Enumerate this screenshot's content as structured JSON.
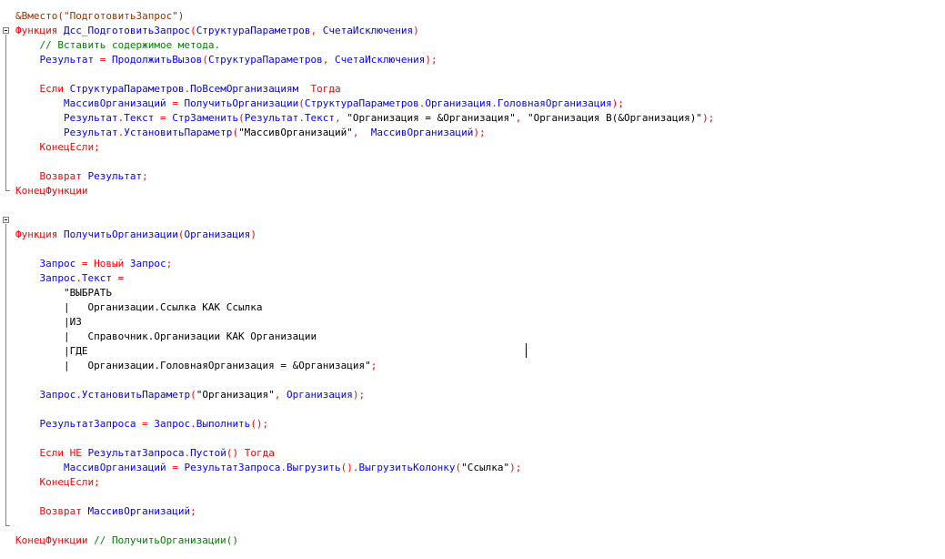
{
  "lines": [
    {
      "name": "line-directive",
      "segs": [
        {
          "t": "&Вместо(\"ПодготовитьЗапрос\")",
          "c": "pp"
        }
      ]
    },
    {
      "name": "line-function-1-header",
      "segs": [
        {
          "t": "Функция ",
          "c": "kw"
        },
        {
          "t": "Дсс_ПодготовитьЗапрос",
          "c": "id"
        },
        {
          "t": "(",
          "c": "kw"
        },
        {
          "t": "СтруктураПараметров",
          "c": "id"
        },
        {
          "t": ", ",
          "c": "kw"
        },
        {
          "t": "СчетаИсключения",
          "c": "id"
        },
        {
          "t": ")",
          "c": "kw"
        }
      ]
    },
    {
      "name": "line-comment-insert",
      "segs": [
        {
          "t": "    // Вставить содержимое метода.",
          "c": "cm"
        }
      ]
    },
    {
      "name": "line-result-assign",
      "segs": [
        {
          "t": "    Результат",
          "c": "id"
        },
        {
          "t": " = ",
          "c": "kw"
        },
        {
          "t": "ПродолжитьВызов",
          "c": "id"
        },
        {
          "t": "(",
          "c": "kw"
        },
        {
          "t": "СтруктураПараметров",
          "c": "id"
        },
        {
          "t": ", ",
          "c": "kw"
        },
        {
          "t": "СчетаИсключения",
          "c": "id"
        },
        {
          "t": ");",
          "c": "kw"
        }
      ]
    },
    {
      "name": "line-blank-1",
      "segs": []
    },
    {
      "name": "line-if-all-orgs",
      "segs": [
        {
          "t": "    Если ",
          "c": "kw"
        },
        {
          "t": "СтруктураПараметров",
          "c": "id"
        },
        {
          "t": ".",
          "c": "kw"
        },
        {
          "t": "ПоВсемОрганизациям",
          "c": "id"
        },
        {
          "t": "  Тогда",
          "c": "kw"
        }
      ]
    },
    {
      "name": "line-orgs-array",
      "segs": [
        {
          "t": "        МассивОрганизаций",
          "c": "id"
        },
        {
          "t": " = ",
          "c": "kw"
        },
        {
          "t": "ПолучитьОрганизации",
          "c": "id"
        },
        {
          "t": "(",
          "c": "kw"
        },
        {
          "t": "СтруктураПараметров",
          "c": "id"
        },
        {
          "t": ".",
          "c": "kw"
        },
        {
          "t": "Организация",
          "c": "id"
        },
        {
          "t": ".",
          "c": "kw"
        },
        {
          "t": "ГоловнаяОрганизация",
          "c": "id"
        },
        {
          "t": ");",
          "c": "kw"
        }
      ]
    },
    {
      "name": "line-replace-text",
      "segs": [
        {
          "t": "        Результат",
          "c": "id"
        },
        {
          "t": ".",
          "c": "kw"
        },
        {
          "t": "Текст",
          "c": "id"
        },
        {
          "t": " = ",
          "c": "kw"
        },
        {
          "t": "СтрЗаменить",
          "c": "id"
        },
        {
          "t": "(",
          "c": "kw"
        },
        {
          "t": "Результат",
          "c": "id"
        },
        {
          "t": ".",
          "c": "kw"
        },
        {
          "t": "Текст",
          "c": "id"
        },
        {
          "t": ", ",
          "c": "kw"
        },
        {
          "t": "\"Организация = &Организация\"",
          "c": "str"
        },
        {
          "t": ", ",
          "c": "kw"
        },
        {
          "t": "\"Организация В(&Организация)\"",
          "c": "str"
        },
        {
          "t": ");",
          "c": "kw"
        }
      ]
    },
    {
      "name": "line-set-param",
      "segs": [
        {
          "t": "        Результат",
          "c": "id"
        },
        {
          "t": ".",
          "c": "kw"
        },
        {
          "t": "УстановитьПараметр",
          "c": "id"
        },
        {
          "t": "(",
          "c": "kw"
        },
        {
          "t": "\"МассивОрганизаций\"",
          "c": "str"
        },
        {
          "t": ",  ",
          "c": "kw"
        },
        {
          "t": "МассивОрганизаций",
          "c": "id"
        },
        {
          "t": ");",
          "c": "kw"
        }
      ]
    },
    {
      "name": "line-endif-1",
      "segs": [
        {
          "t": "    КонецЕсли;",
          "c": "kw"
        }
      ]
    },
    {
      "name": "line-blank-2",
      "segs": []
    },
    {
      "name": "line-return-result",
      "segs": [
        {
          "t": "    Возврат ",
          "c": "kw"
        },
        {
          "t": "Результат",
          "c": "id"
        },
        {
          "t": ";",
          "c": "kw"
        }
      ]
    },
    {
      "name": "line-end-function-1",
      "segs": [
        {
          "t": "КонецФункции",
          "c": "kw"
        }
      ]
    },
    {
      "name": "line-blank-3",
      "segs": []
    },
    {
      "name": "line-blank-4",
      "segs": []
    },
    {
      "name": "line-function-2-header",
      "segs": [
        {
          "t": "Функция ",
          "c": "kw"
        },
        {
          "t": "ПолучитьОрганизации",
          "c": "id"
        },
        {
          "t": "(",
          "c": "kw"
        },
        {
          "t": "Организация",
          "c": "id"
        },
        {
          "t": ")",
          "c": "kw"
        }
      ]
    },
    {
      "name": "line-blank-5",
      "segs": []
    },
    {
      "name": "line-query-new",
      "segs": [
        {
          "t": "    Запрос",
          "c": "id"
        },
        {
          "t": " = ",
          "c": "kw"
        },
        {
          "t": "Новый ",
          "c": "kw"
        },
        {
          "t": "Запрос",
          "c": "id"
        },
        {
          "t": ";",
          "c": "kw"
        }
      ]
    },
    {
      "name": "line-query-text",
      "segs": [
        {
          "t": "    Запрос",
          "c": "id"
        },
        {
          "t": ".",
          "c": "kw"
        },
        {
          "t": "Текст",
          "c": "id"
        },
        {
          "t": " =",
          "c": "kw"
        }
      ]
    },
    {
      "name": "line-q-select",
      "segs": [
        {
          "t": "        \"ВЫБРАТЬ",
          "c": "str"
        }
      ]
    },
    {
      "name": "line-q-field",
      "segs": [
        {
          "t": "        |   Организации.Ссылка КАК Ссылка",
          "c": "str"
        }
      ]
    },
    {
      "name": "line-q-from",
      "segs": [
        {
          "t": "        |ИЗ",
          "c": "str"
        }
      ]
    },
    {
      "name": "line-q-source",
      "segs": [
        {
          "t": "        |   Справочник.Организации КАК Организации",
          "c": "str"
        }
      ]
    },
    {
      "name": "line-q-where",
      "segs": [
        {
          "t": "        |ГДЕ",
          "c": "str"
        }
      ]
    },
    {
      "name": "line-q-condition",
      "segs": [
        {
          "t": "        |   Организации.ГоловнаяОрганизация = &Организация\"",
          "c": "str"
        },
        {
          "t": ";",
          "c": "kw"
        }
      ]
    },
    {
      "name": "line-blank-6",
      "segs": []
    },
    {
      "name": "line-query-set-param",
      "segs": [
        {
          "t": "    Запрос",
          "c": "id"
        },
        {
          "t": ".",
          "c": "kw"
        },
        {
          "t": "УстановитьПараметр",
          "c": "id"
        },
        {
          "t": "(",
          "c": "kw"
        },
        {
          "t": "\"Организация\"",
          "c": "str"
        },
        {
          "t": ", ",
          "c": "kw"
        },
        {
          "t": "Организация",
          "c": "id"
        },
        {
          "t": ");",
          "c": "kw"
        }
      ]
    },
    {
      "name": "line-blank-7",
      "segs": []
    },
    {
      "name": "line-query-execute",
      "segs": [
        {
          "t": "    РезультатЗапроса",
          "c": "id"
        },
        {
          "t": " = ",
          "c": "kw"
        },
        {
          "t": "Запрос",
          "c": "id"
        },
        {
          "t": ".",
          "c": "kw"
        },
        {
          "t": "Выполнить",
          "c": "id"
        },
        {
          "t": "();",
          "c": "kw"
        }
      ]
    },
    {
      "name": "line-blank-8",
      "segs": []
    },
    {
      "name": "line-if-not-empty",
      "segs": [
        {
          "t": "    Если НЕ ",
          "c": "kw"
        },
        {
          "t": "РезультатЗапроса",
          "c": "id"
        },
        {
          "t": ".",
          "c": "kw"
        },
        {
          "t": "Пустой",
          "c": "id"
        },
        {
          "t": "() ",
          "c": "kw"
        },
        {
          "t": "Тогда",
          "c": "kw"
        }
      ]
    },
    {
      "name": "line-unload",
      "segs": [
        {
          "t": "        МассивОрганизаций",
          "c": "id"
        },
        {
          "t": " = ",
          "c": "kw"
        },
        {
          "t": "РезультатЗапроса",
          "c": "id"
        },
        {
          "t": ".",
          "c": "kw"
        },
        {
          "t": "Выгрузить",
          "c": "id"
        },
        {
          "t": "().",
          "c": "kw"
        },
        {
          "t": "ВыгрузитьКолонку",
          "c": "id"
        },
        {
          "t": "(",
          "c": "kw"
        },
        {
          "t": "\"Ссылка\"",
          "c": "str"
        },
        {
          "t": ");",
          "c": "kw"
        }
      ]
    },
    {
      "name": "line-endif-2",
      "segs": [
        {
          "t": "    КонецЕсли;",
          "c": "kw"
        }
      ]
    },
    {
      "name": "line-blank-9",
      "segs": []
    },
    {
      "name": "line-return-array",
      "segs": [
        {
          "t": "    Возврат ",
          "c": "kw"
        },
        {
          "t": "МассивОрганизаций",
          "c": "id"
        },
        {
          "t": ";",
          "c": "kw"
        }
      ]
    },
    {
      "name": "line-blank-10",
      "segs": []
    },
    {
      "name": "line-end-function-2",
      "segs": [
        {
          "t": "КонецФункции ",
          "c": "kw"
        },
        {
          "t": "// ПолучитьОрганизации()",
          "c": "cm"
        }
      ]
    }
  ],
  "colors": {
    "keyword": "#ff0000",
    "identifier": "#0000ff",
    "string": "#000000",
    "comment": "#008000",
    "directive": "#963200",
    "background": "#ffffff"
  }
}
